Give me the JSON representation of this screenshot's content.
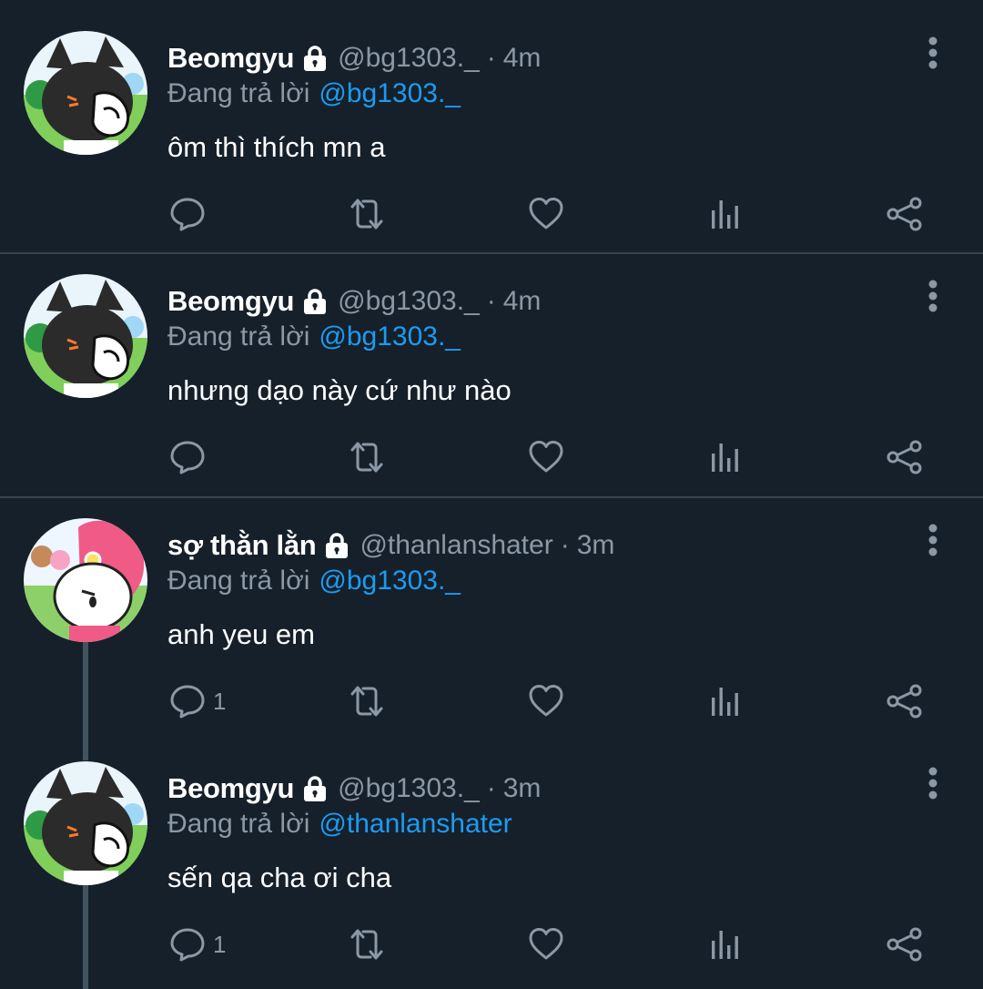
{
  "colors": {
    "background": "#15202b",
    "secondary_text": "#8b98a5",
    "mention": "#1d9bf0",
    "divider": "#38444d",
    "thread_line": "#42535f"
  },
  "replying_label": "Đang trả lời",
  "tweets": [
    {
      "name": "Beomgyu",
      "handle": "@bg1303._",
      "sep": "·",
      "time": "4m",
      "replying_to": "@bg1303._",
      "text": "ôm thì thích mn a",
      "reply_count": "",
      "avatar": "black-bunny-avatar"
    },
    {
      "name": "Beomgyu",
      "handle": "@bg1303._",
      "sep": "·",
      "time": "4m",
      "replying_to": "@bg1303._",
      "text": "nhưng dạo này cứ như nào",
      "reply_count": "",
      "avatar": "black-bunny-avatar"
    },
    {
      "name": "sợ thằn lằn",
      "handle": "@thanlanshater",
      "sep": "·",
      "time": "3m",
      "replying_to": "@bg1303._",
      "text": "anh yeu em",
      "reply_count": "1",
      "avatar": "pink-bunny-avatar"
    },
    {
      "name": "Beomgyu",
      "handle": "@bg1303._",
      "sep": "·",
      "time": "3m",
      "replying_to": "@thanlanshater",
      "text": "sến qa cha ơi cha",
      "reply_count": "1",
      "avatar": "black-bunny-avatar"
    }
  ],
  "icons": [
    "lock-icon",
    "more-icon",
    "reply-icon",
    "retweet-icon",
    "like-icon",
    "views-icon",
    "share-icon"
  ]
}
